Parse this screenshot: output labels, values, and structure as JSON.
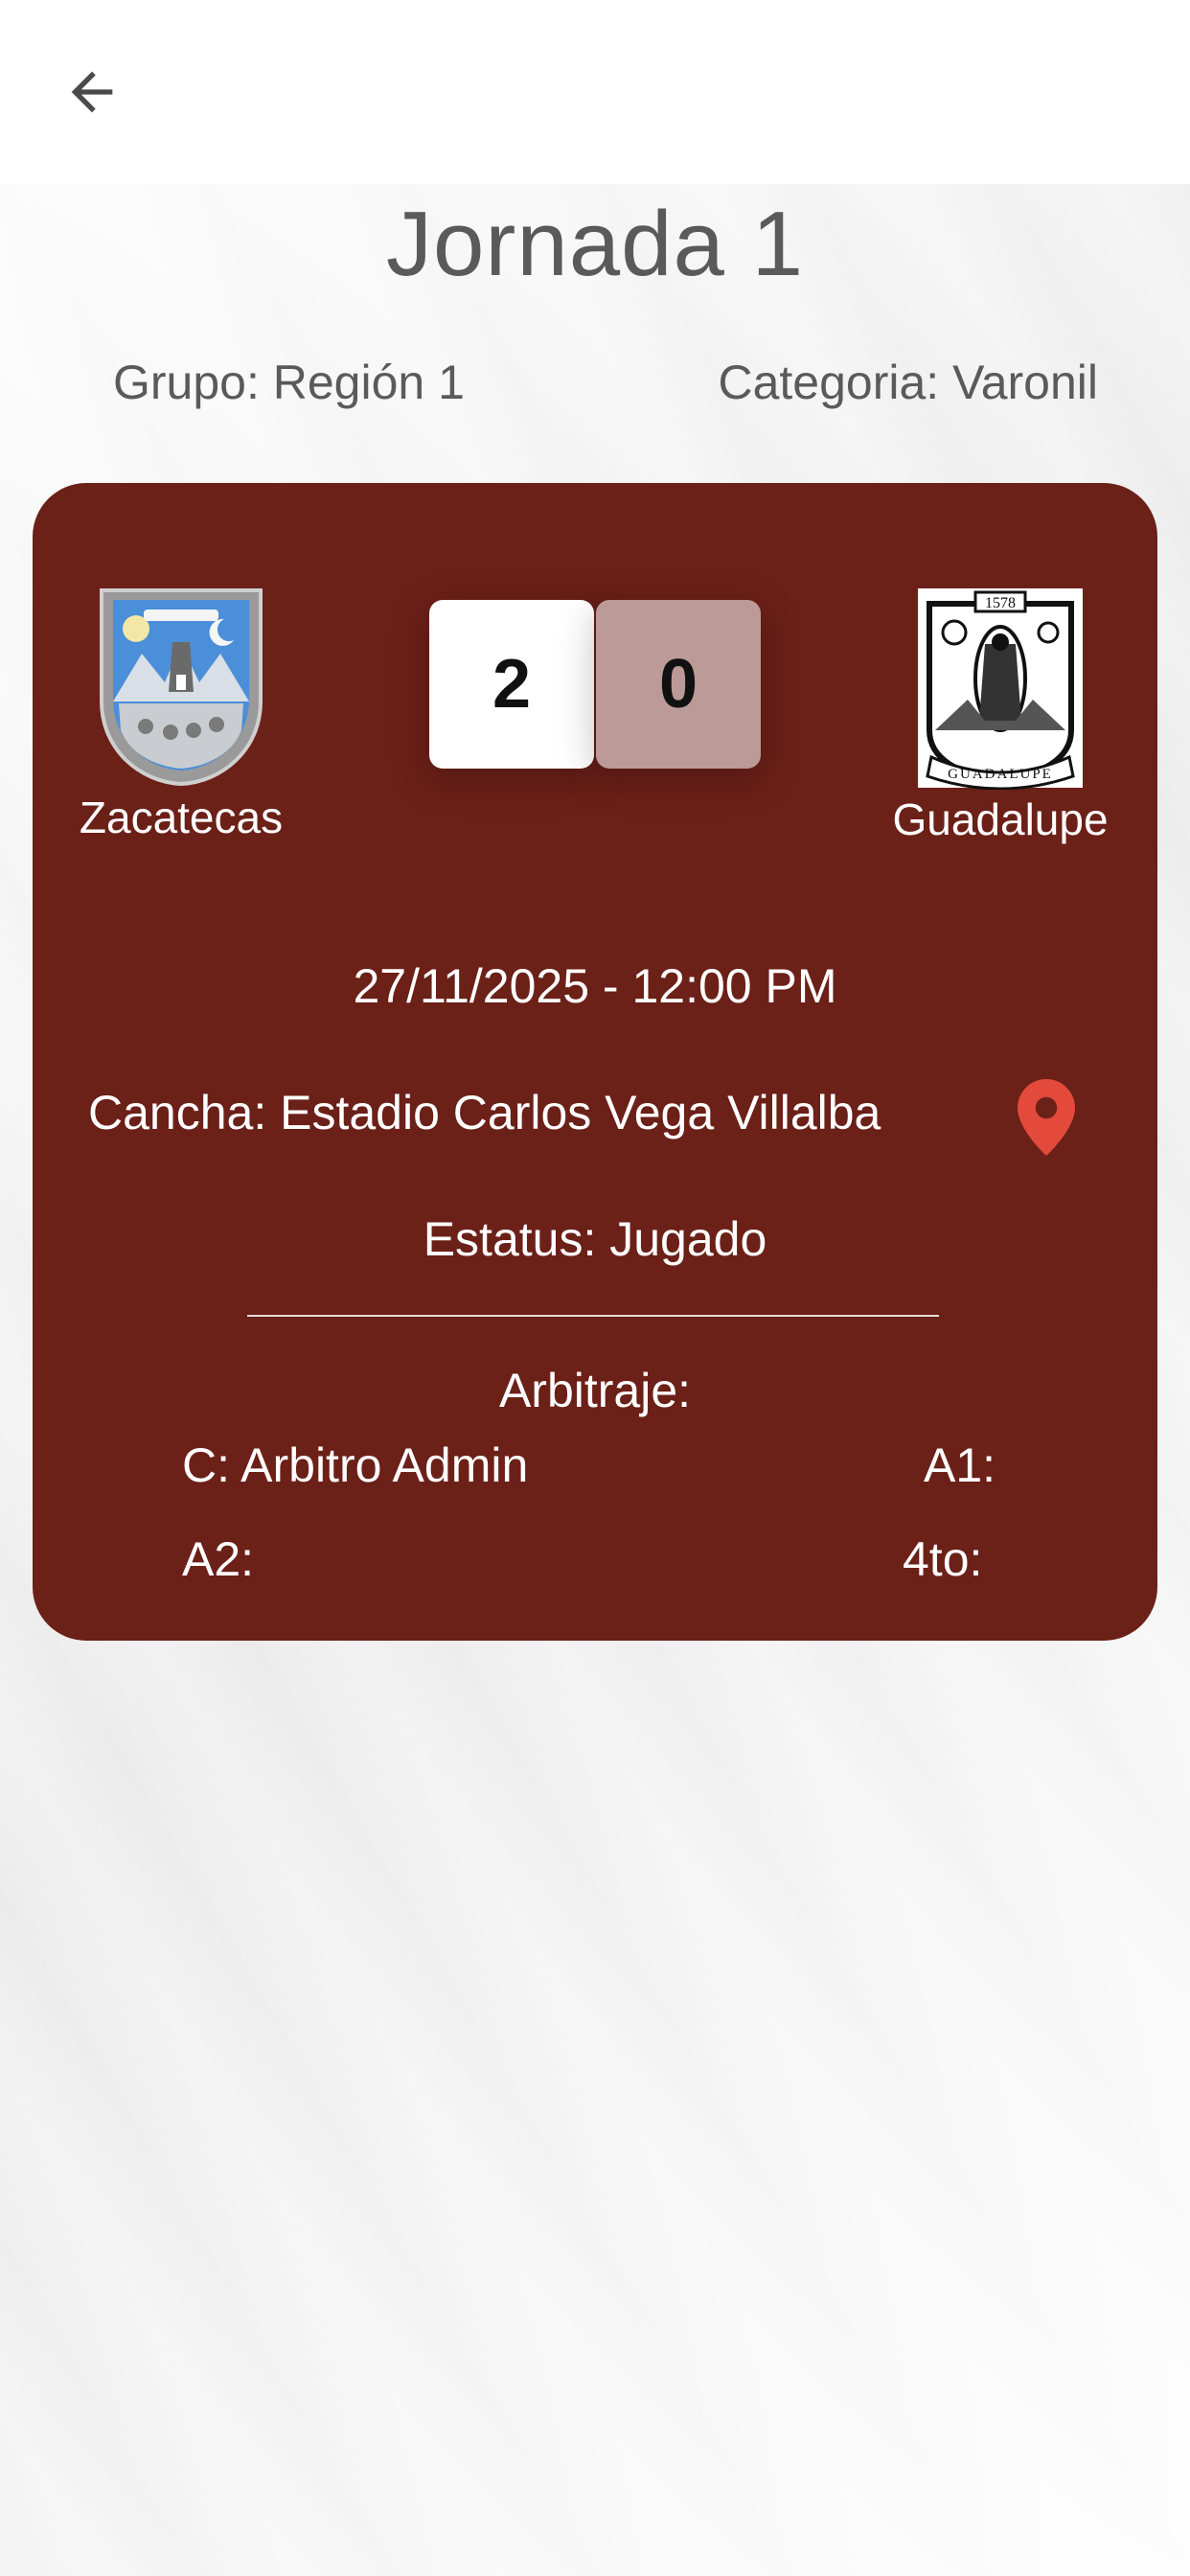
{
  "header": {
    "back_icon": "arrow-left-icon"
  },
  "page": {
    "title": "Jornada 1",
    "group": "Grupo: Región 1",
    "category": "Categoria: Varonil"
  },
  "match": {
    "home_team": "Zacatecas",
    "away_team": "Guadalupe",
    "home_score": "2",
    "away_score": "0",
    "datetime": "27/11/2025 - 12:00 PM",
    "venue": "Cancha: Estadio Carlos Vega Villalba",
    "status": "Estatus: Jugado",
    "referees_title": "Arbitraje:",
    "referee_c": "C: Arbitro Admin",
    "referee_a1": "A1:",
    "referee_a2": "A2:",
    "referee_4to": "4to:",
    "crest_year": "1578",
    "crest_banner": "GUADALUPE"
  },
  "colors": {
    "card": "#6b2018",
    "pin": "#e34a3c",
    "score_away_bg": "#bb9a98",
    "text_muted": "#5a5a5a"
  }
}
